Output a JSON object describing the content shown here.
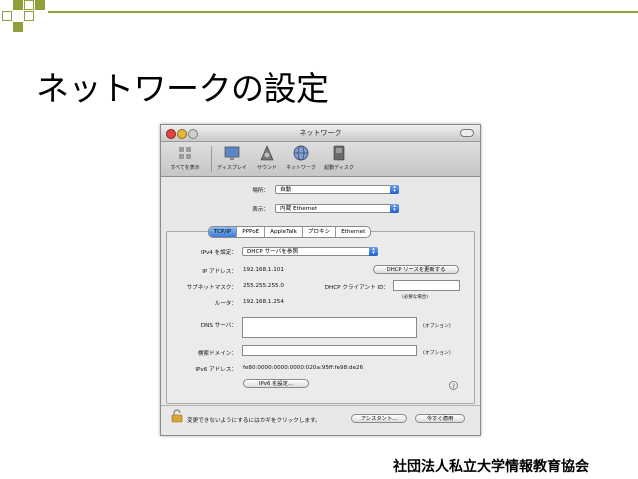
{
  "slide": {
    "title": "ネットワークの設定",
    "footer": "社団法人私立大学情報教育協会",
    "accent_color": "#8ea03a"
  },
  "window": {
    "title": "ネットワーク",
    "toolbar": [
      {
        "label": "すべてを表示",
        "icon": "grid-icon"
      },
      {
        "label": "ディスプレイ",
        "icon": "display-icon"
      },
      {
        "label": "サウンド",
        "icon": "speaker-icon"
      },
      {
        "label": "ネットワーク",
        "icon": "network-globe-icon"
      },
      {
        "label": "起動ディスク",
        "icon": "startup-disk-icon"
      }
    ],
    "location": {
      "label": "場所：",
      "value": "自動"
    },
    "show": {
      "label": "表示：",
      "value": "内蔵 Ethernet"
    },
    "tabs": [
      "TCP/IP",
      "PPPoE",
      "AppleTalk",
      "プロキシ",
      "Ethernet"
    ],
    "ipv4": {
      "label": "IPv4 を設定：",
      "value": "DHCP サーバを参照"
    },
    "ip": {
      "label": "IP アドレス：",
      "value": "192.168.1.101"
    },
    "renew_button": "DHCP リースを更新する",
    "subnet": {
      "label": "サブネットマスク：",
      "value": "255.255.255.0"
    },
    "client_id": {
      "label": "DHCP クライアント ID：",
      "value": "",
      "hint": "(必要な場合)"
    },
    "router": {
      "label": "ルータ：",
      "value": "192.168.1.254"
    },
    "dns": {
      "label": "DNS サーバ：",
      "value": "",
      "hint": "(オプション)"
    },
    "search": {
      "label": "検索ドメイン：",
      "value": "",
      "hint": "(オプション)"
    },
    "ipv6": {
      "label": "IPv6 アドレス：",
      "value": "fe80:0000:0000:0000:020a:95ff:fe98:de26"
    },
    "ipv6_button": "IPv6 を設定...",
    "help": "?",
    "lock_text": "変更できないようにするにはカギをクリックします。",
    "assist_button": "アシスタント...",
    "apply_button": "今すぐ適用"
  }
}
